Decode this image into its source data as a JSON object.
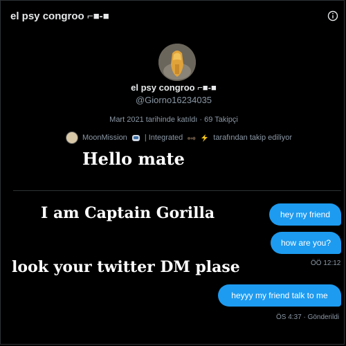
{
  "header": {
    "title": "el psy congroo ⌐■-■",
    "info_icon": "info-circle-icon"
  },
  "profile": {
    "name": "el psy congroo ⌐■-■",
    "handle": "@Giorno16234035",
    "meta": "Mart 2021 tarihinde katıldı · 69 Takipçi",
    "followed_by": {
      "name_part1": "MoonMission",
      "name_part2": "| Integrated",
      "suffix": "tarafından takip ediliyor",
      "icons": [
        "astronaut-emoji-icon",
        "ant-emoji-icon",
        "lightning-emoji-icon"
      ]
    }
  },
  "overlays": {
    "line1": "Hello mate",
    "line2": "I am Captain Gorilla",
    "line3": "look your twitter DM plase"
  },
  "messages": [
    {
      "text": "hey my friend"
    },
    {
      "text": "how are you?"
    },
    {
      "text": "heyyy my friend talk to me"
    }
  ],
  "timestamps": {
    "first": "ÖÖ 12:12",
    "second": "ÖS 4:37 · Gönderildi"
  },
  "colors": {
    "accent": "#1d9bf0",
    "background": "#000000",
    "muted": "#8b98a5"
  }
}
